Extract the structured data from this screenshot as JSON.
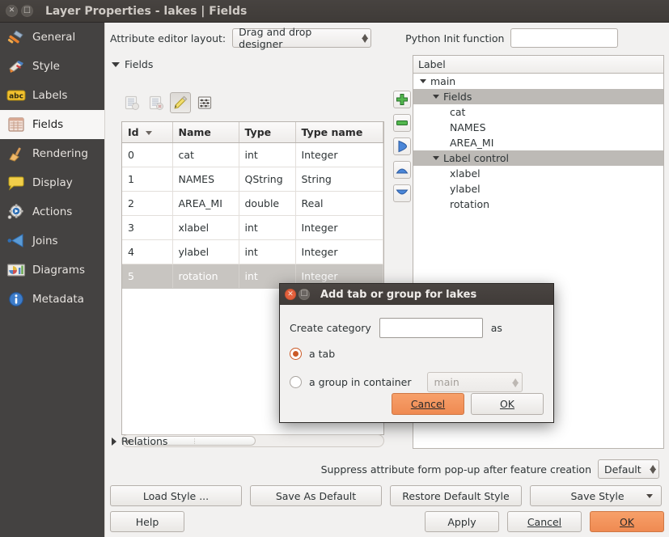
{
  "window": {
    "title": "Layer Properties - lakes | Fields",
    "close_icon": "close-icon",
    "maximize_icon": "maximize-icon"
  },
  "sidebar": {
    "items": [
      {
        "label": "General",
        "icon": "hammer-icon",
        "active": false
      },
      {
        "label": "Style",
        "icon": "brush-icon",
        "active": false
      },
      {
        "label": "Labels",
        "icon": "abc-label-icon",
        "active": false
      },
      {
        "label": "Fields",
        "icon": "table-icon",
        "active": true
      },
      {
        "label": "Rendering",
        "icon": "broom-icon",
        "active": false
      },
      {
        "label": "Display",
        "icon": "speech-bubble-icon",
        "active": false
      },
      {
        "label": "Actions",
        "icon": "gear-play-icon",
        "active": false
      },
      {
        "label": "Joins",
        "icon": "join-arrow-icon",
        "active": false
      },
      {
        "label": "Diagrams",
        "icon": "chart-icon",
        "active": false
      },
      {
        "label": "Metadata",
        "icon": "info-icon",
        "active": false
      }
    ]
  },
  "main": {
    "attribute_editor_layout_label": "Attribute editor layout:",
    "attribute_editor_layout_value": "Drag and drop designer",
    "python_init_label": "Python Init function",
    "python_init_value": "",
    "python_init_placeholder": "",
    "fields_group_label": "Fields",
    "relations_group_label": "Relations",
    "field_toolbar": [
      {
        "name": "new-field-button",
        "icon": "new-field-icon",
        "enabled": false,
        "pressed": false
      },
      {
        "name": "delete-field-button",
        "icon": "delete-field-icon",
        "enabled": false,
        "pressed": false
      },
      {
        "name": "toggle-editing-button",
        "icon": "pencil-icon",
        "enabled": true,
        "pressed": true
      },
      {
        "name": "field-calculator-button",
        "icon": "calculator-icon",
        "enabled": true,
        "pressed": false
      }
    ],
    "table": {
      "columns": [
        "Id",
        "Name",
        "Type",
        "Type name"
      ],
      "sorted_column": "Id",
      "rows": [
        {
          "id": "0",
          "name": "cat",
          "type": "int",
          "type_name": "Integer",
          "selected": false
        },
        {
          "id": "1",
          "name": "NAMES",
          "type": "QString",
          "type_name": "String",
          "selected": false
        },
        {
          "id": "2",
          "name": "AREA_MI",
          "type": "double",
          "type_name": "Real",
          "selected": false
        },
        {
          "id": "3",
          "name": "xlabel",
          "type": "int",
          "type_name": "Integer",
          "selected": false
        },
        {
          "id": "4",
          "name": "ylabel",
          "type": "int",
          "type_name": "Integer",
          "selected": false
        },
        {
          "id": "5",
          "name": "rotation",
          "type": "int",
          "type_name": "Integer",
          "selected": true
        }
      ]
    },
    "tree_toolbar": [
      {
        "name": "add-item-button",
        "icon": "plus-icon"
      },
      {
        "name": "remove-item-button",
        "icon": "minus-icon"
      },
      {
        "name": "add-field-button",
        "icon": "arrow-right-icon"
      },
      {
        "name": "move-up-button",
        "icon": "arrow-up-icon"
      },
      {
        "name": "move-down-button",
        "icon": "arrow-down-icon"
      }
    ],
    "tree": {
      "header": "Label",
      "nodes": [
        {
          "label": "main",
          "depth": 0,
          "expandable": true,
          "highlighted": false
        },
        {
          "label": "Fields",
          "depth": 1,
          "expandable": true,
          "highlighted": true
        },
        {
          "label": "cat",
          "depth": 2,
          "expandable": false,
          "highlighted": false
        },
        {
          "label": "NAMES",
          "depth": 2,
          "expandable": false,
          "highlighted": false
        },
        {
          "label": "AREA_MI",
          "depth": 2,
          "expandable": false,
          "highlighted": false
        },
        {
          "label": "Label control",
          "depth": 1,
          "expandable": true,
          "highlighted": true
        },
        {
          "label": "xlabel",
          "depth": 2,
          "expandable": false,
          "highlighted": false
        },
        {
          "label": "ylabel",
          "depth": 2,
          "expandable": false,
          "highlighted": false
        },
        {
          "label": "rotation",
          "depth": 2,
          "expandable": false,
          "highlighted": false
        }
      ]
    },
    "suppress_label": "Suppress attribute form pop-up after feature creation",
    "suppress_value": "Default",
    "style_buttons": [
      {
        "name": "load-style-button",
        "label": "Load Style ...",
        "split": false
      },
      {
        "name": "save-as-default-button",
        "label": "Save As Default",
        "split": false
      },
      {
        "name": "restore-default-style-button",
        "label": "Restore Default Style",
        "split": false
      },
      {
        "name": "save-style-button",
        "label": "Save Style",
        "split": true
      }
    ],
    "dialog_buttons": {
      "help": "Help",
      "apply": "Apply",
      "cancel": "Cancel",
      "ok": "OK"
    }
  },
  "modal": {
    "title": "Add tab or group for lakes",
    "close_icon": "close-icon",
    "maximize_icon": "maximize-icon",
    "create_category_label": "Create category",
    "create_category_value": "",
    "as_label": "as",
    "option_tab_label": "a tab",
    "option_tab_selected": true,
    "option_group_label": "a group in container",
    "option_group_selected": false,
    "container_value": "main",
    "cancel_label": "Cancel",
    "ok_label": "OK"
  },
  "colors": {
    "titlebar": "#443f3c",
    "sidebar": "#444241",
    "accent_orange": "#ef8a52",
    "radio_orange": "#cb5a26",
    "selection_grey": "#c8c5c1",
    "tree_highlight": "#bdbab6",
    "panel_bg": "#f2f1f0"
  }
}
